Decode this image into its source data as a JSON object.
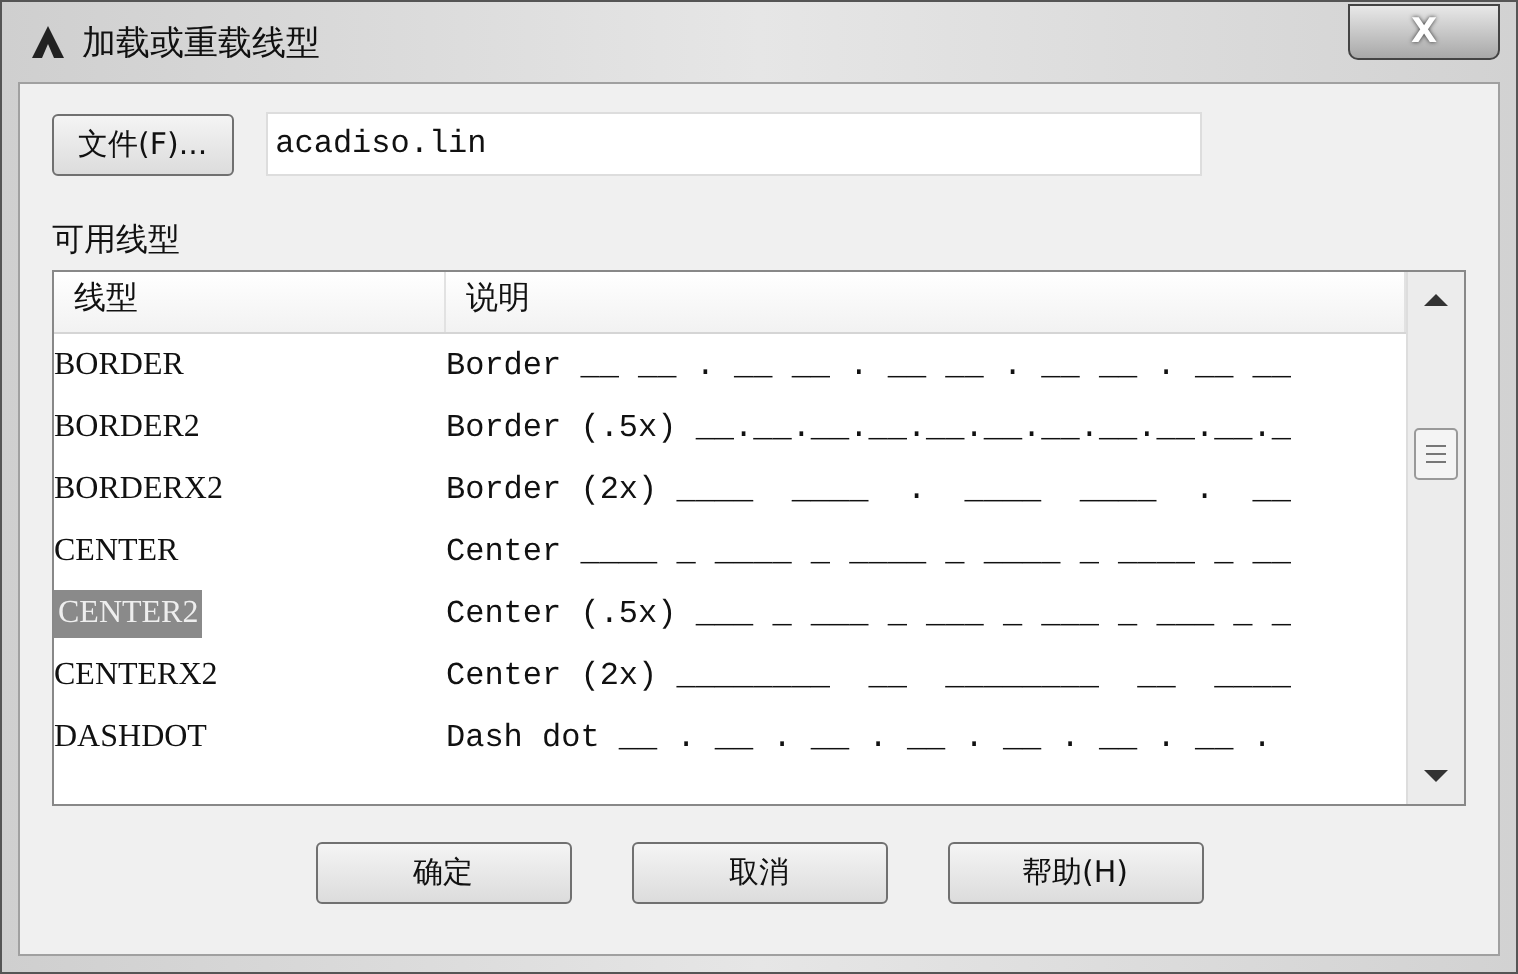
{
  "window": {
    "title": "加载或重载线型",
    "close": "X"
  },
  "file_button": "文件(F)...",
  "file_field": {
    "value": "acadiso.lin"
  },
  "list_label": "可用线型",
  "table": {
    "columns": [
      "线型",
      "说明"
    ],
    "rows": [
      {
        "name": "BORDER",
        "description": "Border __ __ . __ __ . __ __ . __ __ . __ __",
        "selected": false
      },
      {
        "name": "BORDER2",
        "description": "Border (.5x) __.__.__.__.__.__.__.__.__.__._",
        "selected": false
      },
      {
        "name": "BORDERX2",
        "description": "Border (2x) ____  ____  .  ____  ____  .  __",
        "selected": false
      },
      {
        "name": "CENTER",
        "description": "Center ____ _ ____ _ ____ _ ____ _ ____ _ __",
        "selected": false
      },
      {
        "name": "CENTER2",
        "description": "Center (.5x) ___ _ ___ _ ___ _ ___ _ ___ _ _",
        "selected": true
      },
      {
        "name": "CENTERX2",
        "description": "Center (2x) ________  __  ________  __  ____",
        "selected": false
      },
      {
        "name": "DASHDOT",
        "description": "Dash dot __ . __ . __ . __ . __ . __ . __ .",
        "selected": false
      }
    ]
  },
  "buttons": [
    "确定",
    "取消",
    "帮助(H)"
  ]
}
